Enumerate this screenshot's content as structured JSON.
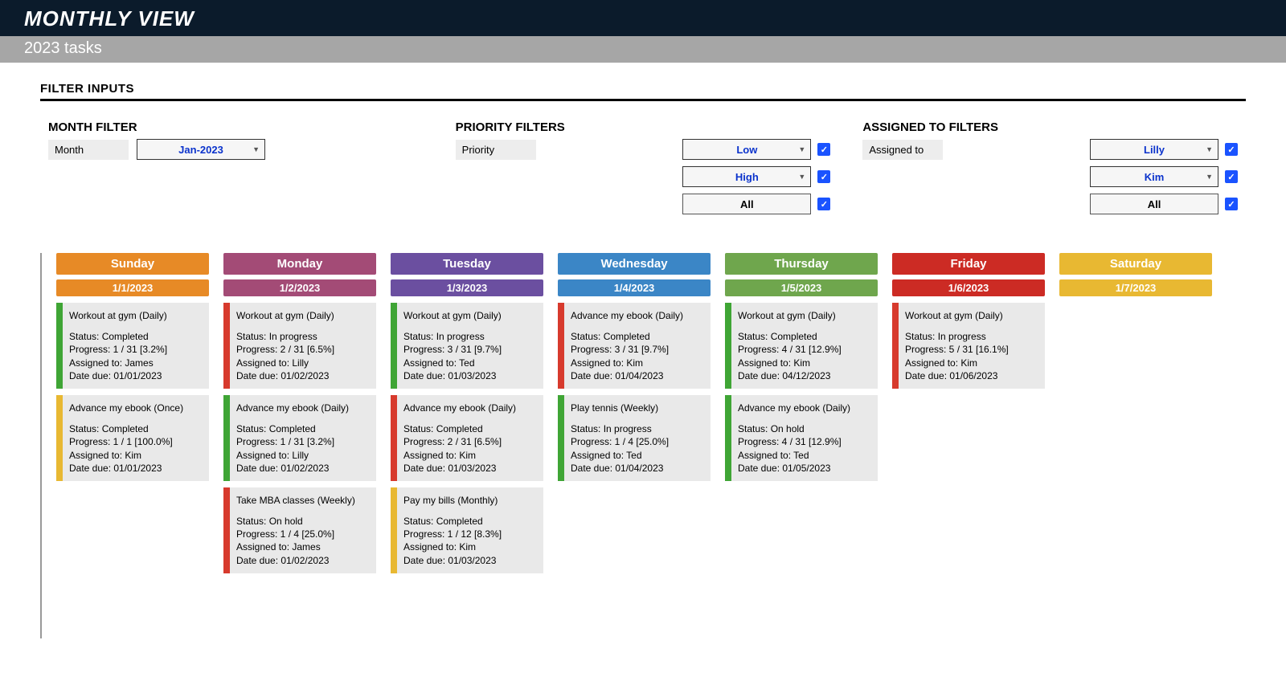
{
  "header": {
    "title": "MONTHLY VIEW",
    "subtitle": "2023 tasks"
  },
  "filter_inputs": {
    "title": "FILTER INPUTS",
    "month": {
      "title": "MONTH FILTER",
      "label": "Month",
      "value": "Jan-2023"
    },
    "priority": {
      "title": "PRIORITY FILTERS",
      "label": "Priority",
      "options": [
        {
          "value": "Low",
          "checked": true,
          "highlight": true
        },
        {
          "value": "High",
          "checked": true,
          "highlight": true
        },
        {
          "value": "All",
          "checked": true,
          "highlight": false
        }
      ]
    },
    "assigned": {
      "title": "ASSIGNED TO FILTERS",
      "label": "Assigned to",
      "options": [
        {
          "value": "Lilly",
          "checked": true,
          "highlight": true
        },
        {
          "value": "Kim",
          "checked": true,
          "highlight": true
        },
        {
          "value": "All",
          "checked": true,
          "highlight": false
        }
      ]
    }
  },
  "days": [
    {
      "name": "Sunday",
      "date": "1/1/2023",
      "color": "sunday",
      "tasks": [
        {
          "stripe": "green",
          "title": "Workout at gym (Daily)",
          "status": "Completed",
          "progress": "1 / 31  [3.2%]",
          "assigned": "James",
          "due": "01/01/2023"
        },
        {
          "stripe": "yellow",
          "title": "Advance my ebook (Once)",
          "status": "Completed",
          "progress": "1 / 1  [100.0%]",
          "assigned": "Kim",
          "due": "01/01/2023"
        }
      ]
    },
    {
      "name": "Monday",
      "date": "1/2/2023",
      "color": "monday",
      "tasks": [
        {
          "stripe": "red",
          "title": "Workout at gym (Daily)",
          "status": "In progress",
          "progress": "2 / 31  [6.5%]",
          "assigned": "Lilly",
          "due": "01/02/2023"
        },
        {
          "stripe": "green",
          "title": "Advance my ebook (Daily)",
          "status": "Completed",
          "progress": "1 / 31  [3.2%]",
          "assigned": "Lilly",
          "due": "01/02/2023"
        },
        {
          "stripe": "red",
          "title": "Take MBA classes (Weekly)",
          "status": "On hold",
          "progress": "1 / 4  [25.0%]",
          "assigned": "James",
          "due": "01/02/2023"
        }
      ]
    },
    {
      "name": "Tuesday",
      "date": "1/3/2023",
      "color": "tuesday",
      "tasks": [
        {
          "stripe": "green",
          "title": "Workout at gym (Daily)",
          "status": "In progress",
          "progress": "3 / 31  [9.7%]",
          "assigned": "Ted",
          "due": "01/03/2023"
        },
        {
          "stripe": "red",
          "title": "Advance my ebook (Daily)",
          "status": "Completed",
          "progress": "2 / 31  [6.5%]",
          "assigned": "Kim",
          "due": "01/03/2023"
        },
        {
          "stripe": "yellow",
          "title": "Pay my bills (Monthly)",
          "status": "Completed",
          "progress": "1 / 12  [8.3%]",
          "assigned": "Kim",
          "due": "01/03/2023"
        }
      ]
    },
    {
      "name": "Wednesday",
      "date": "1/4/2023",
      "color": "wednesday",
      "tasks": [
        {
          "stripe": "red",
          "title": "Advance my ebook (Daily)",
          "status": "Completed",
          "progress": "3 / 31  [9.7%]",
          "assigned": "Kim",
          "due": "01/04/2023"
        },
        {
          "stripe": "green",
          "title": "Play tennis (Weekly)",
          "status": "In progress",
          "progress": "1 / 4  [25.0%]",
          "assigned": "Ted",
          "due": "01/04/2023"
        }
      ]
    },
    {
      "name": "Thursday",
      "date": "1/5/2023",
      "color": "thursday",
      "tasks": [
        {
          "stripe": "green",
          "title": "Workout at gym (Daily)",
          "status": "Completed",
          "progress": "4 / 31  [12.9%]",
          "assigned": "Kim",
          "due": "04/12/2023"
        },
        {
          "stripe": "green",
          "title": "Advance my ebook (Daily)",
          "status": "On hold",
          "progress": "4 / 31  [12.9%]",
          "assigned": "Ted",
          "due": "01/05/2023"
        }
      ]
    },
    {
      "name": "Friday",
      "date": "1/6/2023",
      "color": "friday",
      "tasks": [
        {
          "stripe": "red",
          "title": "Workout at gym (Daily)",
          "status": "In progress",
          "progress": "5 / 31  [16.1%]",
          "assigned": "Kim",
          "due": "01/06/2023"
        }
      ]
    },
    {
      "name": "Saturday",
      "date": "1/7/2023",
      "color": "saturday",
      "tasks": []
    }
  ],
  "labels": {
    "status": "Status: ",
    "progress": "Progress: ",
    "assigned": "Assigned to: ",
    "due": "Date due: "
  }
}
